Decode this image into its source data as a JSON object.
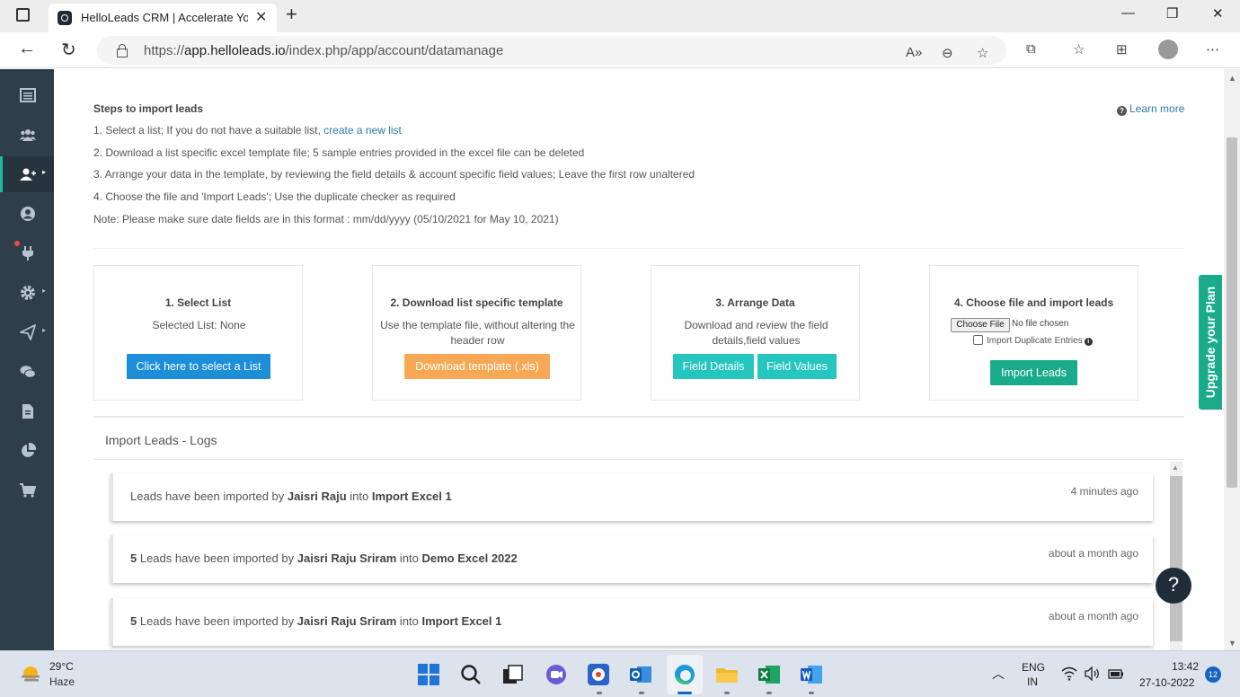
{
  "browser": {
    "tab_title": "HelloLeads CRM | Accelerate Your",
    "url_prefix": "https://",
    "url_host": "app.helloleads.io",
    "url_path": "/index.php/app/account/datamanage"
  },
  "steps": {
    "title": "Steps to import leads",
    "learn_more": "Learn more",
    "line1_text": "1. Select a list; If you do not have a suitable list, ",
    "line1_link": "create a new list",
    "line2": "2. Download a list specific excel template file; 5 sample entries provided in the excel file can be deleted",
    "line3": "3. Arrange your data in the template, by reviewing the field details & account specific field values; Leave the first row unaltered",
    "line4": "4. Choose the file and 'Import Leads'; Use the duplicate checker as required",
    "note": "Note: Please make sure date fields are in this format : mm/dd/yyyy (05/10/2021 for May 10, 2021)"
  },
  "cards": {
    "select": {
      "title": "1. Select List",
      "sub": "Selected List: None",
      "button": "Click here to select a List"
    },
    "download": {
      "title": "2. Download list specific template",
      "sub": "Use the template file, without altering the header row",
      "button": "Download template (.xls)"
    },
    "arrange": {
      "title": "3. Arrange Data",
      "sub": "Download and review the field details,field values",
      "button1": "Field Details",
      "button2": "Field Values"
    },
    "import": {
      "title": "4. Choose file and import leads",
      "file_button": "Choose File",
      "file_status": "No file chosen",
      "duplicate_label": "Import Duplicate Entries",
      "button": "Import Leads"
    }
  },
  "logs": {
    "title": "Import Leads - Logs",
    "items": [
      {
        "count": "",
        "pre": "Leads have been imported by ",
        "user": "Jaisri Raju",
        "mid": " into ",
        "list": "Import Excel 1",
        "time": "4 minutes ago"
      },
      {
        "count": "5",
        "pre": " Leads have been imported by ",
        "user": "Jaisri Raju Sriram",
        "mid": " into ",
        "list": "Demo Excel 2022",
        "time": "about a month ago"
      },
      {
        "count": "5",
        "pre": " Leads have been imported by ",
        "user": "Jaisri Raju Sriram",
        "mid": " into ",
        "list": "Import Excel 1",
        "time": "about a month ago"
      }
    ]
  },
  "upgrade_label": "Upgrade your Plan",
  "help_label": "?",
  "taskbar": {
    "temp": "29°C",
    "weather": "Haze",
    "lang1": "ENG",
    "lang2": "IN",
    "time": "13:42",
    "date": "27-10-2022",
    "notifications": "12"
  },
  "colors": {
    "sidebar": "#2f3e4b",
    "accent_teal": "#1aac8a",
    "button_blue": "#1d8fd8",
    "button_orange": "#f7a855",
    "button_cyan": "#26c6c0",
    "link": "#2a7ab8"
  }
}
